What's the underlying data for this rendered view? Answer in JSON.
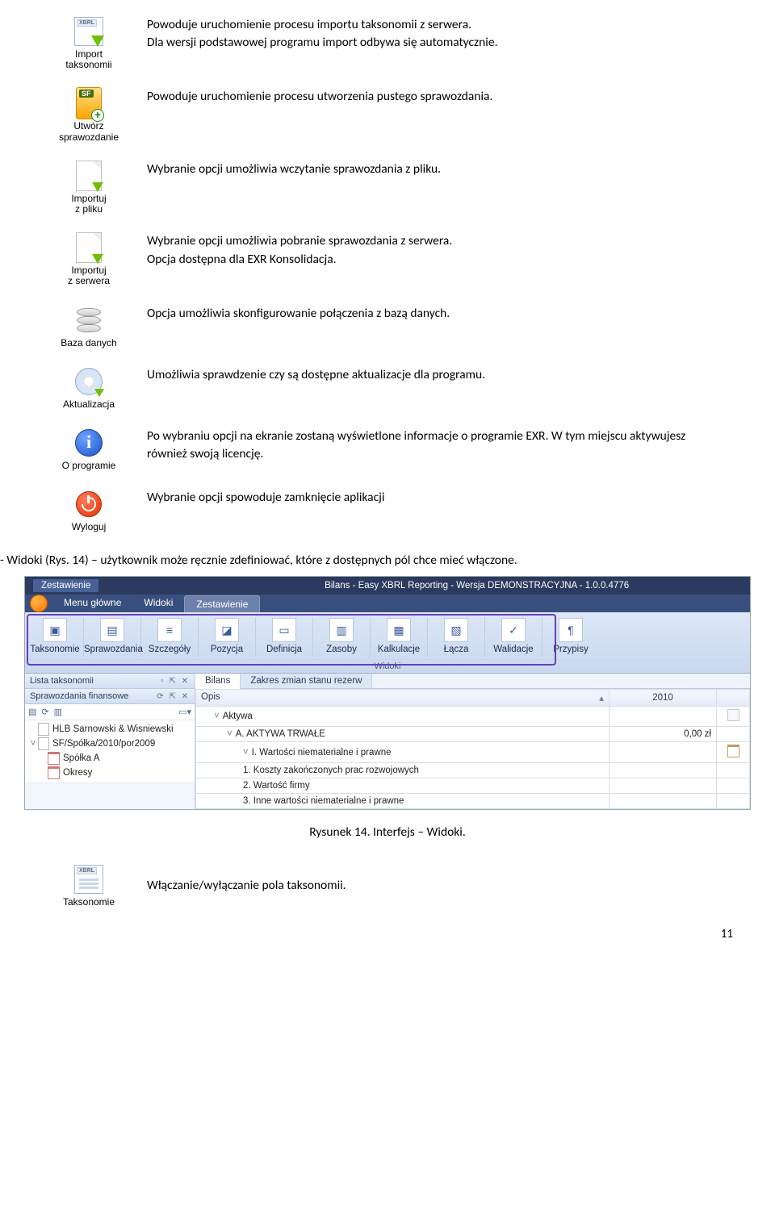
{
  "icons": [
    {
      "label": "Import\ntaksonomii",
      "desc": "Powoduje uruchomienie procesu importu taksonomii z serwera.\nDla wersji podstawowej programu import odbywa się automatycznie."
    },
    {
      "label": "Utwórz\nsprawozdanie",
      "desc": "Powoduje uruchomienie procesu utworzenia pustego sprawozdania."
    },
    {
      "label": "Importuj\nz pliku",
      "desc": "Wybranie opcji umożliwia wczytanie sprawozdania z pliku."
    },
    {
      "label": "Importuj\nz serwera",
      "desc": "Wybranie opcji umożliwia pobranie sprawozdania z serwera.\nOpcja dostępna dla EXR Konsolidacja."
    },
    {
      "label": "Baza danych",
      "desc": "Opcja umożliwia skonfigurowanie połączenia z bazą danych."
    },
    {
      "label": "Aktualizacja",
      "desc": "Umożliwia sprawdzenie czy są dostępne aktualizacje dla programu."
    },
    {
      "label": "O programie",
      "desc": "Po wybraniu opcji na ekranie zostaną wyświetlone informacje o programie EXR. W tym miejscu aktywujesz również swoją licencję."
    },
    {
      "label": "Wyloguj",
      "desc": "Wybranie opcji spowoduje zamknięcie aplikacji"
    }
  ],
  "widoki_para": "- Widoki (Rys. 14) – użytkownik może ręcznie zdefiniować, które z dostępnych pól chce mieć włączone.",
  "shot": {
    "tab_header": "Zestawienie",
    "window_title": "Bilans - Easy XBRL Reporting - Wersja DEMONSTRACYJNA - 1.0.0.4776",
    "menubar": [
      "Menu główne",
      "Widoki",
      "Zestawienie"
    ],
    "menubar_active": 2,
    "ribbon_buttons": [
      "Taksonomie",
      "Sprawozdania",
      "Szczegóły",
      "Pozycja",
      "Definicja",
      "Zasoby",
      "Kalkulacje",
      "Łącza",
      "Walidacje",
      "Przypisy"
    ],
    "ribbon_group": "Widoki",
    "left_panel1_title": "Lista taksonomii",
    "left_panel2_title": "Sprawozdania finansowe",
    "tree": [
      "HLB Sarnowski & Wisniewski",
      "SF/Spółka/2010/por2009",
      "Spółka A",
      "Okresy"
    ],
    "doc_tabs": [
      "Bilans",
      "Zakres zmian stanu rezerw"
    ],
    "doc_tab_active": 0,
    "grid": {
      "headers": [
        "Opis",
        "2010"
      ],
      "rows": [
        {
          "indent": 1,
          "chev": "˅",
          "text": "Aktywa",
          "year": "",
          "right": "a"
        },
        {
          "indent": 2,
          "chev": "˅",
          "text": "A. AKTYWA TRWAŁE",
          "year": "0,00 zł",
          "right": ""
        },
        {
          "indent": 3,
          "chev": "˅",
          "text": "I. Wartości niematerialne i prawne",
          "year": "",
          "right": "cal"
        },
        {
          "indent": 3,
          "chev": "",
          "text": "1. Koszty zakończonych prac rozwojowych",
          "year": "",
          "right": ""
        },
        {
          "indent": 3,
          "chev": "",
          "text": "2. Wartość firmy",
          "year": "",
          "right": ""
        },
        {
          "indent": 3,
          "chev": "",
          "text": "3. Inne wartości niematerialne i prawne",
          "year": "",
          "right": ""
        }
      ]
    }
  },
  "caption": "Rysunek 14. Interfejs – Widoki.",
  "bottom": {
    "label": "Taksonomie",
    "desc": "Włączanie/wyłączanie pola taksonomii."
  },
  "page_num": "11"
}
